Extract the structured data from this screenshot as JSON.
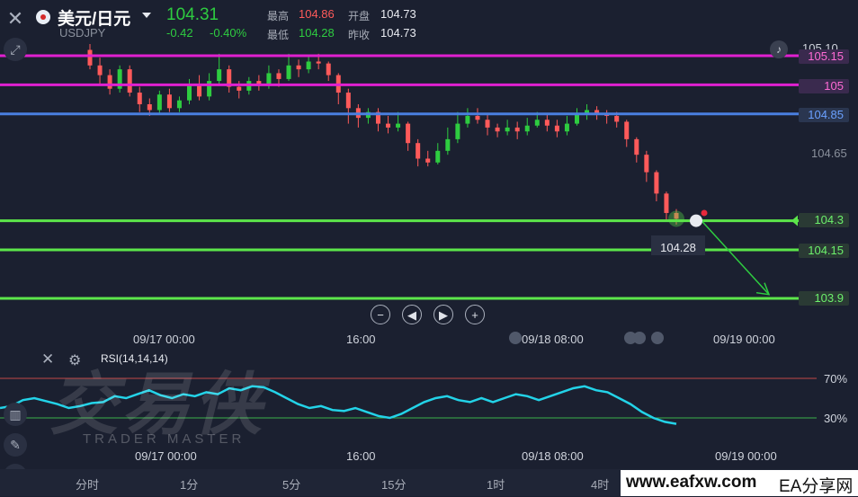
{
  "header": {
    "symbol_name": "美元/日元",
    "symbol_code": "USDJPY",
    "price": "104.31",
    "change": "-0.42",
    "change_pct": "-0.40%",
    "high_label": "最高",
    "high_value": "104.86",
    "low_label": "最低",
    "low_value": "104.28",
    "open_label": "开盘",
    "open_value": "104.73",
    "prev_label": "昨收",
    "prev_value": "104.73"
  },
  "price_levels": {
    "top_partial": "105.10",
    "l1": "105.15",
    "l2": "105",
    "l3": "104.85",
    "axis": "104.65",
    "l4": "104.3",
    "l5": "104.15",
    "l6": "103.9"
  },
  "cursor_price": "104.28",
  "time_axis": [
    "09/17 00:00",
    "16:00",
    "09/18 08:00",
    "09/19 00:00"
  ],
  "time_axis_fragment": "09/1",
  "rsi": {
    "title": "RSI(14,14,14)",
    "upper": "70%",
    "lower": "30%",
    "time_axis": [
      "09/17 00:00",
      "16:00",
      "09/18 08:00",
      "09/19 00:00"
    ]
  },
  "timeframes": [
    "分时",
    "1分",
    "5分",
    "15分",
    "1时",
    "4时"
  ],
  "watermark": {
    "cn": "交易侠",
    "en": "TRADER MASTER",
    "site": "www.eafxw.com",
    "site_cn": "EA分享网"
  },
  "colors": {
    "bg": "#1b2030",
    "up": "#2ecc40",
    "down": "#ff5a5a",
    "magenta": "#e020d0",
    "blue": "#4a7fe0",
    "green_line": "#5ce64a",
    "rsi": "#23d3e8"
  },
  "chart_data": {
    "type": "candlestick",
    "candles": [
      [
        105.18,
        105.1,
        105.21,
        105.08
      ],
      [
        105.1,
        105.05,
        105.14,
        105.0
      ],
      [
        105.05,
        104.98,
        105.08,
        104.95
      ],
      [
        104.98,
        105.08,
        105.1,
        104.96
      ],
      [
        105.08,
        104.96,
        105.1,
        104.94
      ],
      [
        104.96,
        104.9,
        104.99,
        104.86
      ],
      [
        104.9,
        104.87,
        104.93,
        104.84
      ],
      [
        104.87,
        104.95,
        104.97,
        104.85
      ],
      [
        104.95,
        104.88,
        104.98,
        104.86
      ],
      [
        104.88,
        104.92,
        104.94,
        104.86
      ],
      [
        104.92,
        105.0,
        105.03,
        104.9
      ],
      [
        105.0,
        104.94,
        105.05,
        104.92
      ],
      [
        104.94,
        105.02,
        105.06,
        104.92
      ],
      [
        105.02,
        105.08,
        105.16,
        105.0
      ],
      [
        105.08,
        104.99,
        105.1,
        104.96
      ],
      [
        104.99,
        104.97,
        105.02,
        104.93
      ],
      [
        104.97,
        105.02,
        105.04,
        104.95
      ],
      [
        105.02,
        105.0,
        105.05,
        104.97
      ],
      [
        105.0,
        105.06,
        105.1,
        104.98
      ],
      [
        105.06,
        105.03,
        105.08,
        104.99
      ],
      [
        105.03,
        105.1,
        105.16,
        105.02
      ],
      [
        105.1,
        105.08,
        105.13,
        105.04
      ],
      [
        105.08,
        105.12,
        105.15,
        105.06
      ],
      [
        105.12,
        105.11,
        105.16,
        105.08
      ],
      [
        105.11,
        105.05,
        105.12,
        105.02
      ],
      [
        105.05,
        104.96,
        105.06,
        104.9
      ],
      [
        104.96,
        104.88,
        104.98,
        104.8
      ],
      [
        104.88,
        104.83,
        104.9,
        104.78
      ],
      [
        104.83,
        104.86,
        104.88,
        104.8
      ],
      [
        104.86,
        104.8,
        104.88,
        104.76
      ],
      [
        104.8,
        104.78,
        104.84,
        104.75
      ],
      [
        104.78,
        104.8,
        104.86,
        104.76
      ],
      [
        104.8,
        104.7,
        104.81,
        104.66
      ],
      [
        104.7,
        104.62,
        104.72,
        104.58
      ],
      [
        104.62,
        104.6,
        104.66,
        104.58
      ],
      [
        104.6,
        104.66,
        104.7,
        104.59
      ],
      [
        104.66,
        104.72,
        104.78,
        104.64
      ],
      [
        104.72,
        104.8,
        104.86,
        104.7
      ],
      [
        104.8,
        104.84,
        104.88,
        104.78
      ],
      [
        104.84,
        104.82,
        104.88,
        104.8
      ],
      [
        104.82,
        104.78,
        104.85,
        104.74
      ],
      [
        104.78,
        104.76,
        104.8,
        104.73
      ],
      [
        104.76,
        104.78,
        104.82,
        104.74
      ],
      [
        104.78,
        104.76,
        104.81,
        104.72
      ],
      [
        104.76,
        104.79,
        104.83,
        104.74
      ],
      [
        104.79,
        104.82,
        104.86,
        104.78
      ],
      [
        104.82,
        104.79,
        104.85,
        104.76
      ],
      [
        104.79,
        104.76,
        104.82,
        104.73
      ],
      [
        104.76,
        104.8,
        104.84,
        104.74
      ],
      [
        104.8,
        104.85,
        104.88,
        104.79
      ],
      [
        104.85,
        104.87,
        104.9,
        104.82
      ],
      [
        104.87,
        104.85,
        104.89,
        104.82
      ],
      [
        104.85,
        104.84,
        104.87,
        104.8
      ],
      [
        104.84,
        104.81,
        104.86,
        104.78
      ],
      [
        104.81,
        104.72,
        104.82,
        104.68
      ],
      [
        104.72,
        104.64,
        104.73,
        104.6
      ],
      [
        104.64,
        104.55,
        104.66,
        104.5
      ],
      [
        104.55,
        104.44,
        104.56,
        104.4
      ],
      [
        104.44,
        104.34,
        104.45,
        104.3
      ],
      [
        104.34,
        104.31,
        104.36,
        104.28
      ]
    ],
    "rsi": [
      40,
      42,
      48,
      50,
      47,
      44,
      40,
      42,
      45,
      46,
      52,
      50,
      54,
      58,
      53,
      50,
      54,
      52,
      56,
      54,
      60,
      58,
      62,
      61,
      56,
      50,
      44,
      40,
      42,
      38,
      37,
      40,
      36,
      32,
      30,
      34,
      40,
      46,
      50,
      52,
      48,
      46,
      50,
      46,
      50,
      54,
      52,
      48,
      52,
      56,
      60,
      62,
      58,
      56,
      50,
      44,
      36,
      30,
      26,
      24
    ]
  }
}
